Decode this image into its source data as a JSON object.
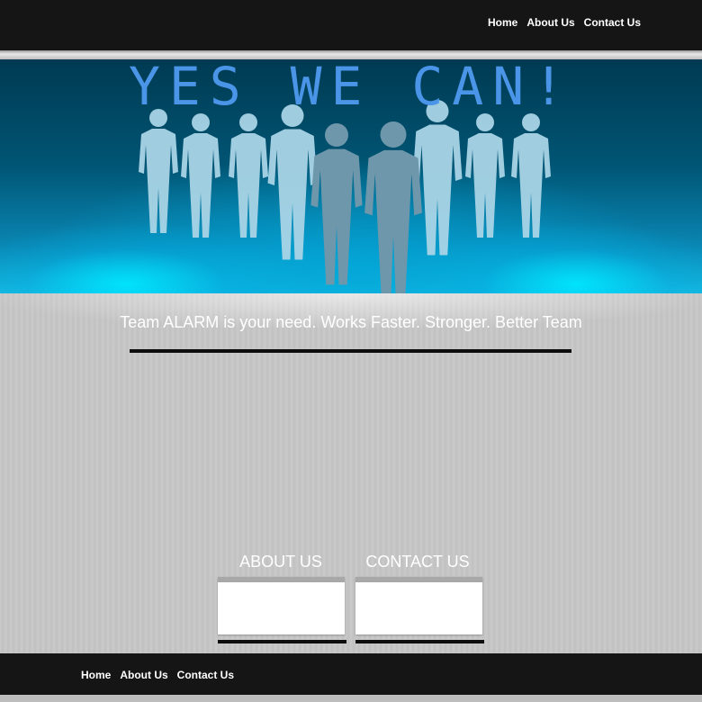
{
  "header": {
    "nav": [
      "Home",
      "About Us",
      "Contact Us"
    ]
  },
  "hero": {
    "title": "YES WE CAN!"
  },
  "content": {
    "tagline": "Team ALARM is your need. Works Faster. Stronger. Better Team",
    "about_title": "ABOUT US",
    "contact_title": "CONTACT US"
  },
  "footer": {
    "nav": [
      "Home",
      "About Us",
      "Contact Us"
    ]
  },
  "colors": {
    "bar": "#151515",
    "hero_blue": "#005574",
    "title_blue": "#4a95e8",
    "silhouette_light": "#a9d4e6",
    "silhouette_dark": "#6e97ab",
    "panel_gray": "#c7c7c7"
  },
  "icons": [
    "team-silhouette-figure"
  ]
}
